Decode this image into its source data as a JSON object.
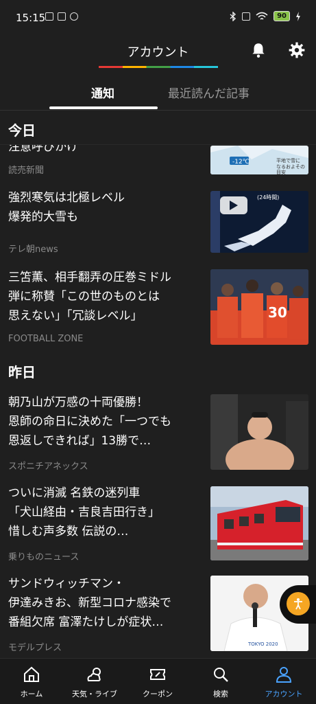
{
  "status": {
    "time": "15:15",
    "battery": "90"
  },
  "header": {
    "title": "アカウント"
  },
  "tabs": [
    {
      "label": "通知"
    },
    {
      "label": "最近読んだ記事"
    }
  ],
  "sections": {
    "today": "今日",
    "yesterday": "昨日"
  },
  "articles": [
    {
      "headline": "注意呼びかけ",
      "source": "読売新聞",
      "thumb_text": "-12℃ 平地で雪に なるおよその 目安"
    },
    {
      "headline": "強烈寒気は北極レベル\n爆発的大雪も",
      "source": "テレ朝news",
      "thumb_text": "(24時間)"
    },
    {
      "headline": "三笘薫、相手翻弄の圧巻ミドル\n弾に称賛「この世のものとは\n思えない」「冗談レベル」",
      "source": "FOOTBALL ZONE",
      "thumb_text": "30"
    },
    {
      "headline": "朝乃山が万感の十両優勝！\n恩師の命日に決めた「一つでも\n恩返しできれば」13勝で…",
      "source": "スポニチアネックス"
    },
    {
      "headline": "ついに消滅 名鉄の迷列車\n「犬山経由・吉良吉田行き」\n惜しむ声多数 伝説の…",
      "source": "乗りものニュース"
    },
    {
      "headline": "サンドウィッチマン・\n伊達みきお、新型コロナ感染で\n番組欠席 富澤たけしが症状…",
      "source": "モデルプレス",
      "thumb_text": "TOKYO 2020"
    }
  ],
  "nav": [
    {
      "label": "ホーム"
    },
    {
      "label": "天気・ライブ"
    },
    {
      "label": "クーポン"
    },
    {
      "label": "検索"
    },
    {
      "label": "アカウント"
    }
  ]
}
